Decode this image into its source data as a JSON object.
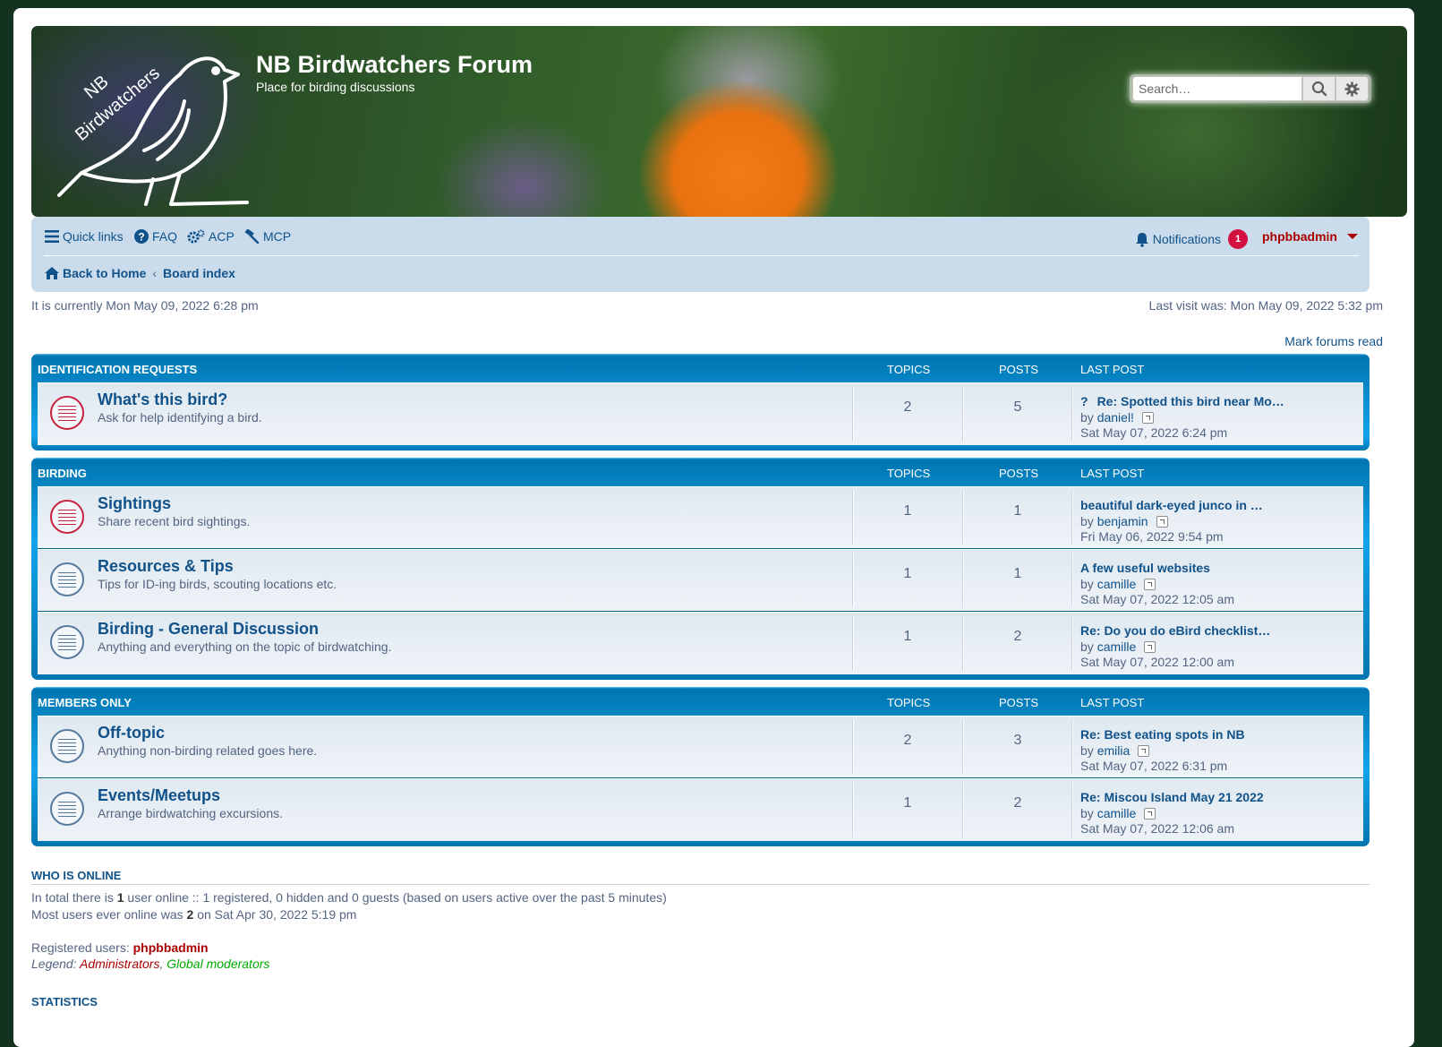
{
  "site": {
    "logo_text_line1": "NB",
    "logo_text_line2": "Birdwatchers",
    "title": "NB Birdwatchers Forum",
    "description": "Place for birding discussions",
    "search_placeholder": "Search…"
  },
  "nav": {
    "quick_links": "Quick links",
    "faq": "FAQ",
    "acp": "ACP",
    "mcp": "MCP",
    "notifications": "Notifications",
    "notifications_count": "1",
    "username": "phpbbadmin",
    "crumb_home": "Back to Home",
    "crumb_sep": "‹",
    "crumb_index": "Board index"
  },
  "status": {
    "current_time": "It is currently Mon May 09, 2022 6:28 pm",
    "last_visit": "Last visit was: Mon May 09, 2022 5:32 pm",
    "mark_read": "Mark forums read"
  },
  "columns": {
    "topics": "TOPICS",
    "posts": "POSTS",
    "last_post": "LAST POST"
  },
  "categories": [
    {
      "name": "IDENTIFICATION REQUESTS",
      "forums": [
        {
          "title": "What's this bird?",
          "desc": "Ask for help identifying a bird.",
          "topics": "2",
          "posts": "5",
          "unread": true,
          "lp_title": "Re: Spotted this bird near Mo…",
          "lp_by": "by",
          "lp_user": "daniel!",
          "lp_time": "Sat May 07, 2022 6:24 pm",
          "lp_q": "?"
        }
      ]
    },
    {
      "name": "BIRDING",
      "forums": [
        {
          "title": "Sightings",
          "desc": "Share recent bird sightings.",
          "topics": "1",
          "posts": "1",
          "unread": true,
          "lp_title": "beautiful dark-eyed junco in …",
          "lp_by": "by",
          "lp_user": "benjamin",
          "lp_time": "Fri May 06, 2022 9:54 pm"
        },
        {
          "title": "Resources & Tips",
          "desc": "Tips for ID-ing birds, scouting locations etc.",
          "topics": "1",
          "posts": "1",
          "unread": false,
          "lp_title": "A few useful websites",
          "lp_by": "by",
          "lp_user": "camille",
          "lp_time": "Sat May 07, 2022 12:05 am"
        },
        {
          "title": "Birding - General Discussion",
          "desc": "Anything and everything on the topic of birdwatching.",
          "topics": "1",
          "posts": "2",
          "unread": false,
          "lp_title": "Re: Do you do eBird checklist…",
          "lp_by": "by",
          "lp_user": "camille",
          "lp_time": "Sat May 07, 2022 12:00 am"
        }
      ]
    },
    {
      "name": "MEMBERS ONLY",
      "forums": [
        {
          "title": "Off-topic",
          "desc": "Anything non-birding related goes here.",
          "topics": "2",
          "posts": "3",
          "unread": false,
          "lp_title": "Re: Best eating spots in NB",
          "lp_by": "by",
          "lp_user": "emilia",
          "lp_time": "Sat May 07, 2022 6:31 pm"
        },
        {
          "title": "Events/Meetups",
          "desc": "Arrange birdwatching excursions.",
          "topics": "1",
          "posts": "2",
          "unread": false,
          "lp_title": "Re: Miscou Island May 21 2022",
          "lp_by": "by",
          "lp_user": "camille",
          "lp_time": "Sat May 07, 2022 12:06 am"
        }
      ]
    }
  ],
  "online": {
    "heading": "WHO IS ONLINE",
    "line1_a": "In total there is ",
    "line1_count": "1",
    "line1_b": " user online :: 1 registered, 0 hidden and 0 guests (based on users active over the past 5 minutes)",
    "line2_a": "Most users ever online was ",
    "line2_count": "2",
    "line2_b": " on Sat Apr 30, 2022 5:19 pm",
    "registered_label": "Registered users: ",
    "registered_user": "phpbbadmin",
    "legend_label": "Legend: ",
    "legend_admin": "Administrators",
    "legend_sep": ", ",
    "legend_gmod": "Global moderators"
  },
  "stats": {
    "heading": "STATISTICS"
  },
  "colors": {
    "admin": "#aa0000",
    "gmod": "#00aa00",
    "link": "#105289",
    "badge": "#d31141"
  }
}
